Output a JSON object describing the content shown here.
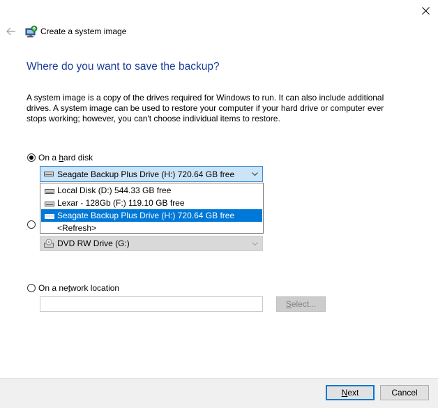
{
  "window": {
    "title": "Create a system image"
  },
  "heading": "Where do you want to save the backup?",
  "description": "A system image is a copy of the drives required for Windows to run. It can also include additional drives. A system image can be used to restore your computer if your hard drive or computer ever stops working; however, you can't choose individual items to restore.",
  "hard_disk": {
    "label_pre": "On a ",
    "label_access": "h",
    "label_post": "ard disk",
    "selected": true,
    "combo_value": "Seagate Backup Plus Drive (H:)  720.64 GB free",
    "options": [
      {
        "label": "Local Disk (D:)  544.33 GB free"
      },
      {
        "label": "Lexar - 128Gb (F:)  119.10 GB free"
      },
      {
        "label": "Seagate Backup Plus Drive (H:)  720.64 GB free"
      },
      {
        "label": "<Refresh>"
      }
    ]
  },
  "dvd": {
    "selected": false,
    "combo_value": "DVD RW Drive (G:)"
  },
  "network": {
    "label_pre": "On a ne",
    "label_access": "t",
    "label_post": "work location",
    "selected": false,
    "input_value": "",
    "select_pre": "",
    "select_access": "S",
    "select_post": "elect..."
  },
  "footer": {
    "next_access": "N",
    "next_post": "ext",
    "cancel": "Cancel"
  },
  "colors": {
    "heading": "#1a3e96",
    "selection": "#0078d7",
    "combo_bg": "#cce4f7"
  }
}
